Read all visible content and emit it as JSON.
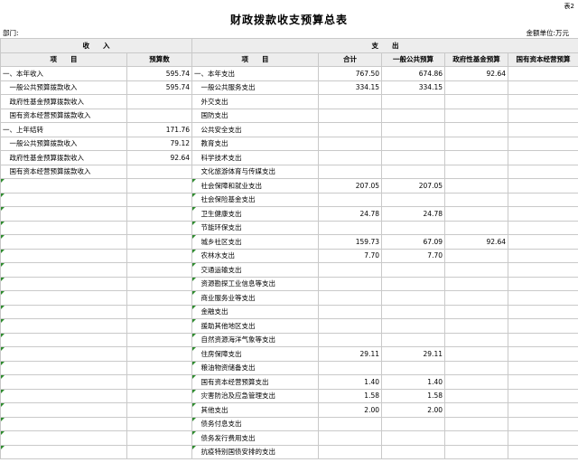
{
  "corner_label": "表2",
  "title": "财政拨款收支预算总表",
  "dept_label": "部门:",
  "unit_label": "金额单位:万元",
  "headers": {
    "income": "收　　入",
    "expense": "支　　出",
    "item": "项　　目",
    "budget": "预算数",
    "expense_item": "项　　目",
    "total": "合计",
    "general": "一般公共预算",
    "fund": "政府性基金预算",
    "state_capital": "国有资本经营预算"
  },
  "rows": [
    {
      "in_label": "一、本年收入",
      "in_value": "595.74",
      "ex_label": "一、本年支出",
      "total": "767.50",
      "general": "674.86",
      "fund": "92.64",
      "capital": ""
    },
    {
      "in_label": "　一般公共预算拨款收入",
      "in_value": "595.74",
      "ex_label": "　一般公共服务支出",
      "total": "334.15",
      "general": "334.15",
      "fund": "",
      "capital": ""
    },
    {
      "in_label": "　政府性基金预算拨款收入",
      "in_value": "",
      "ex_label": "　外交支出",
      "total": "",
      "general": "",
      "fund": "",
      "capital": ""
    },
    {
      "in_label": "　国有资本经营预算拨款收入",
      "in_value": "",
      "ex_label": "　国防支出",
      "total": "",
      "general": "",
      "fund": "",
      "capital": ""
    },
    {
      "in_label": "一、上年结转",
      "in_value": "171.76",
      "ex_label": "　公共安全支出",
      "total": "",
      "general": "",
      "fund": "",
      "capital": ""
    },
    {
      "in_label": "　一般公共预算拨款收入",
      "in_value": "79.12",
      "ex_label": "　教育支出",
      "total": "",
      "general": "",
      "fund": "",
      "capital": ""
    },
    {
      "in_label": "　政府性基金预算拨款收入",
      "in_value": "92.64",
      "ex_label": "　科学技术支出",
      "total": "",
      "general": "",
      "fund": "",
      "capital": ""
    },
    {
      "in_label": "　国有资本经营预算拨款收入",
      "in_value": "",
      "ex_label": "　文化旅游体育与传媒支出",
      "total": "",
      "general": "",
      "fund": "",
      "capital": ""
    },
    {
      "in_label": "",
      "in_value": "",
      "ex_label": "　社会保障和就业支出",
      "total": "207.05",
      "general": "207.05",
      "fund": "",
      "capital": ""
    },
    {
      "in_label": "",
      "in_value": "",
      "ex_label": "　社会保险基金支出",
      "total": "",
      "general": "",
      "fund": "",
      "capital": ""
    },
    {
      "in_label": "",
      "in_value": "",
      "ex_label": "　卫生健康支出",
      "total": "24.78",
      "general": "24.78",
      "fund": "",
      "capital": ""
    },
    {
      "in_label": "",
      "in_value": "",
      "ex_label": "　节能环保支出",
      "total": "",
      "general": "",
      "fund": "",
      "capital": ""
    },
    {
      "in_label": "",
      "in_value": "",
      "ex_label": "　城乡社区支出",
      "total": "159.73",
      "general": "67.09",
      "fund": "92.64",
      "capital": ""
    },
    {
      "in_label": "",
      "in_value": "",
      "ex_label": "　农林水支出",
      "total": "7.70",
      "general": "7.70",
      "fund": "",
      "capital": ""
    },
    {
      "in_label": "",
      "in_value": "",
      "ex_label": "　交通运输支出",
      "total": "",
      "general": "",
      "fund": "",
      "capital": ""
    },
    {
      "in_label": "",
      "in_value": "",
      "ex_label": "　资源勘探工业信息等支出",
      "total": "",
      "general": "",
      "fund": "",
      "capital": ""
    },
    {
      "in_label": "",
      "in_value": "",
      "ex_label": "　商业服务业等支出",
      "total": "",
      "general": "",
      "fund": "",
      "capital": ""
    },
    {
      "in_label": "",
      "in_value": "",
      "ex_label": "　金融支出",
      "total": "",
      "general": "",
      "fund": "",
      "capital": ""
    },
    {
      "in_label": "",
      "in_value": "",
      "ex_label": "　援助其他地区支出",
      "total": "",
      "general": "",
      "fund": "",
      "capital": ""
    },
    {
      "in_label": "",
      "in_value": "",
      "ex_label": "　自然资源海洋气象等支出",
      "total": "",
      "general": "",
      "fund": "",
      "capital": ""
    },
    {
      "in_label": "",
      "in_value": "",
      "ex_label": "　住房保障支出",
      "total": "29.11",
      "general": "29.11",
      "fund": "",
      "capital": ""
    },
    {
      "in_label": "",
      "in_value": "",
      "ex_label": "　粮油物资储备支出",
      "total": "",
      "general": "",
      "fund": "",
      "capital": ""
    },
    {
      "in_label": "",
      "in_value": "",
      "ex_label": "　国有资本经营预算支出",
      "total": "1.40",
      "general": "1.40",
      "fund": "",
      "capital": ""
    },
    {
      "in_label": "",
      "in_value": "",
      "ex_label": "　灾害防治及应急管理支出",
      "total": "1.58",
      "general": "1.58",
      "fund": "",
      "capital": ""
    },
    {
      "in_label": "",
      "in_value": "",
      "ex_label": "　其他支出",
      "total": "2.00",
      "general": "2.00",
      "fund": "",
      "capital": ""
    },
    {
      "in_label": "",
      "in_value": "",
      "ex_label": "　债务付息支出",
      "total": "",
      "general": "",
      "fund": "",
      "capital": ""
    },
    {
      "in_label": "",
      "in_value": "",
      "ex_label": "　债务发行费用支出",
      "total": "",
      "general": "",
      "fund": "",
      "capital": ""
    },
    {
      "in_label": "",
      "in_value": "",
      "ex_label": "　抗疫特别国债安排的支出",
      "total": "",
      "general": "",
      "fund": "",
      "capital": ""
    }
  ]
}
